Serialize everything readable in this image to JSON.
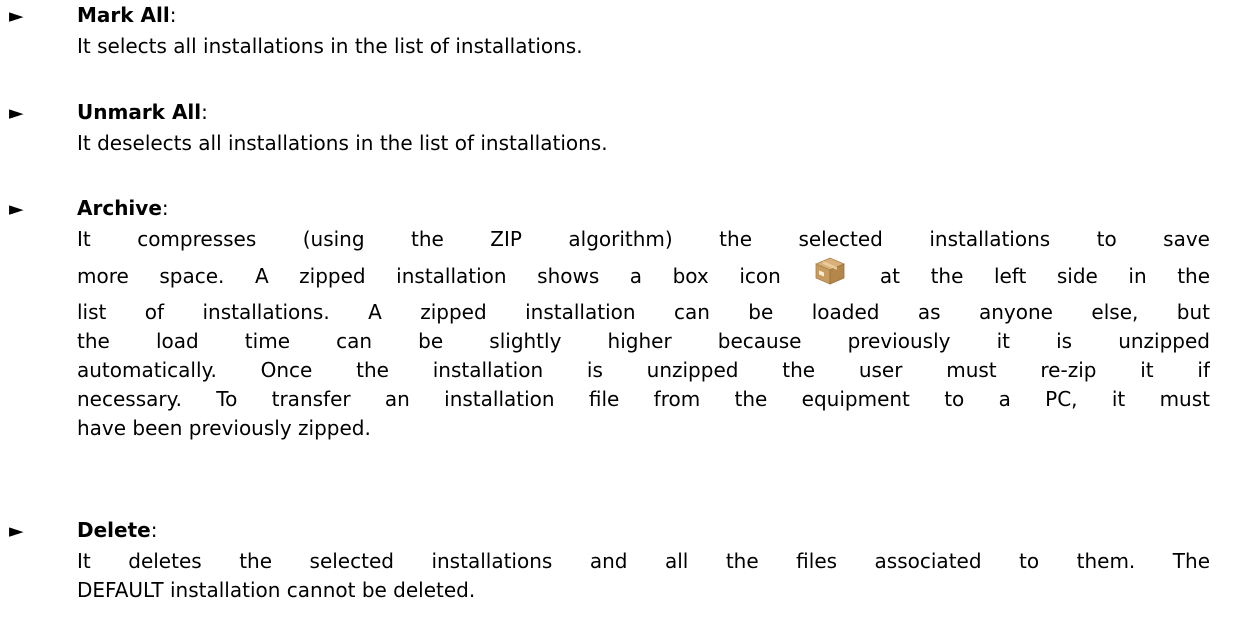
{
  "bullet_glyph": "►",
  "items": [
    {
      "title": "Mark All",
      "colon": ":",
      "lines": [
        "It selects all installations in the list of installations."
      ]
    },
    {
      "title": "Unmark All",
      "colon": ":",
      "lines": [
        "It deselects all installations in the list of installations."
      ]
    },
    {
      "title": "Archive",
      "colon": ":",
      "lines": [
        "It compresses (using the ZIP algorithm) the selected installations to save",
        "more space. A zipped installation shows a box icon",
        "at the left side in the",
        "list of installations. A zipped installation can be loaded as anyone else, but",
        "the load time can be slightly higher because previously it is unzipped",
        "automatically. Once the installation is unzipped the user must re-zip it if",
        "necessary. To transfer an installation file from the equipment to a PC, it must",
        "have been previously zipped."
      ],
      "icon": "zip-box-icon"
    },
    {
      "title": "Delete",
      "colon": ":",
      "lines": [
        "It deletes the selected installations and all the files associated to them. The",
        "DEFAULT installation cannot be deleted."
      ]
    }
  ]
}
